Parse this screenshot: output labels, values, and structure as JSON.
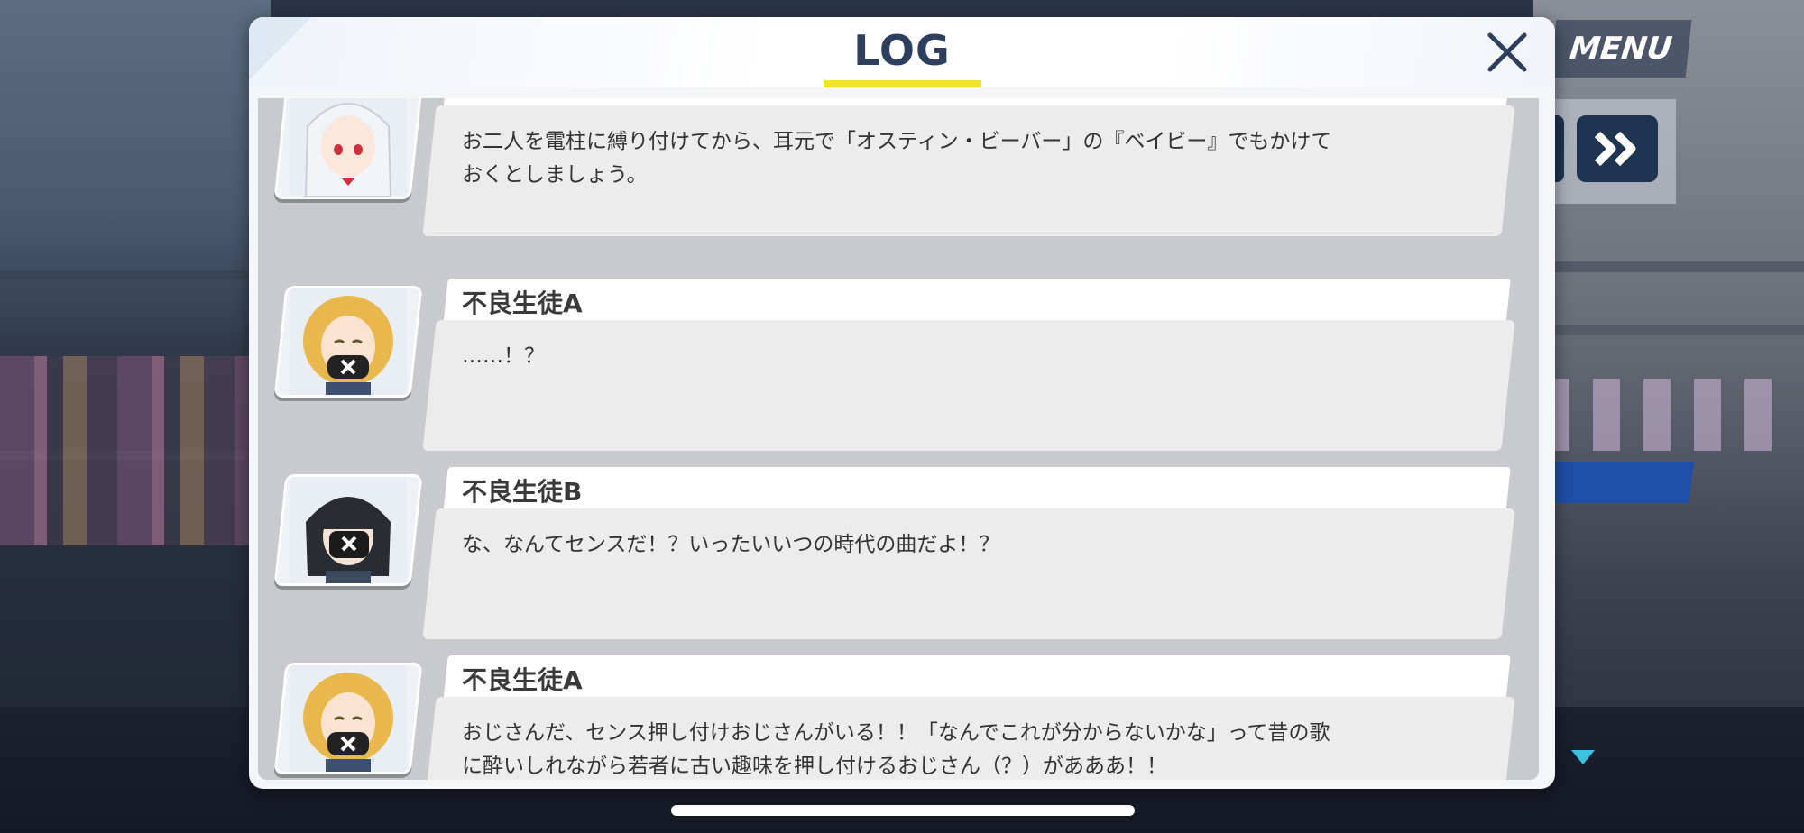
{
  "hud": {
    "menu_label": "MENU",
    "fast_forward_icon": "double-chevron-right-icon",
    "more_indicator_icon": "triangle-down-icon",
    "accent_color": "#3dc1e0"
  },
  "log": {
    "title": "LOG",
    "close_icon": "close-x-icon",
    "underline_color": "#f2e422",
    "entries": [
      {
        "speaker": "",
        "avatar": "white-haired-girl-portrait",
        "text": "お二人を電柱に縛り付けてから、耳元で「オスティン・ビーバー」の『ベイビー』でもかけて\nおくとしましょう。"
      },
      {
        "speaker": "不良生徒A",
        "avatar": "blonde-masked-student-portrait",
        "text": "……！？"
      },
      {
        "speaker": "不良生徒B",
        "avatar": "black-haired-masked-student-portrait",
        "text": "な、なんてセンスだ！？いったいいつの時代の曲だよ！？"
      },
      {
        "speaker": "不良生徒A",
        "avatar": "blonde-masked-student-portrait",
        "text": "おじさんだ、センス押し付けおじさんがいる！！「なんでこれが分からないかな」って昔の歌\nに酔いしれながら若者に古い趣味を押し付けるおじさん（？）があああ！！"
      }
    ]
  }
}
